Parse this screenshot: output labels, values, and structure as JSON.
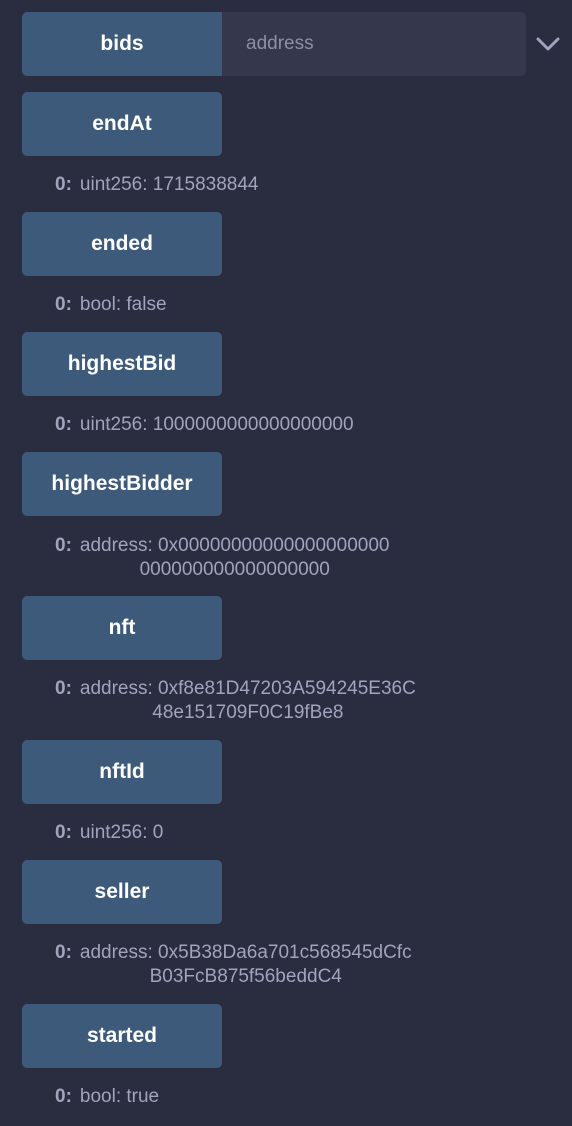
{
  "bids": {
    "button_label": "bids",
    "placeholder": "address"
  },
  "functions": [
    {
      "label": "endAt",
      "index": "0:",
      "value": "uint256: 1715838844"
    },
    {
      "label": "ended",
      "index": "0:",
      "value": "bool: false"
    },
    {
      "label": "highestBid",
      "index": "0:",
      "value": "uint256: 1000000000000000000"
    },
    {
      "label": "highestBidder",
      "index": "0:",
      "value": "address: 0x0000000000000000000000000000000000000000"
    },
    {
      "label": "nft",
      "index": "0:",
      "value": "address: 0xf8e81D47203A594245E36C48e151709F0C19fBe8"
    },
    {
      "label": "nftId",
      "index": "0:",
      "value": "uint256: 0"
    },
    {
      "label": "seller",
      "index": "0:",
      "value": "address: 0x5B38Da6a701c568545dCfcB03FcB875f56beddC4"
    },
    {
      "label": "started",
      "index": "0:",
      "value": "bool: true"
    }
  ],
  "display": {
    "highestBidder": [
      "address: 0x00000000000000000000",
      "000000000000000000"
    ],
    "nft": [
      "address: 0xf8e81D47203A594245E36C",
      "48e151709F0C19fBe8"
    ],
    "seller": [
      "address: 0x5B38Da6a701c568545dCfc",
      "B03FcB875f56beddC4"
    ]
  },
  "icons": {
    "expand": "chevron-down-icon"
  },
  "colors": {
    "background": "#2a2c3f",
    "button": "#3d5a7a",
    "input": "#35374c",
    "text": "#a2a3bd"
  }
}
